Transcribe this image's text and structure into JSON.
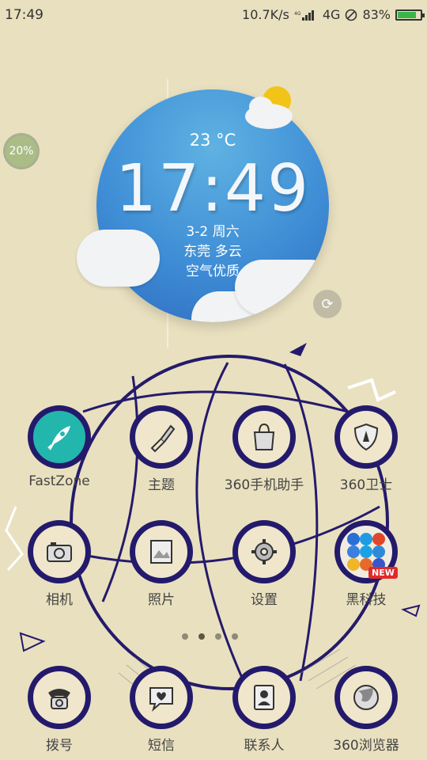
{
  "status_bar": {
    "time": "17:49",
    "network_speed": "10.7K/s",
    "network_type": "4G",
    "battery_percent": "83%",
    "icons": [
      "signal-icon",
      "dnd-icon",
      "battery-icon"
    ]
  },
  "floating_widget": {
    "percent": "20%"
  },
  "weather": {
    "temperature": "23 °C",
    "time": "17:49",
    "date": "3-2 周六",
    "city_condition": "东莞 多云",
    "air_quality": "空气优质"
  },
  "apps": {
    "row1": [
      {
        "label": "FastZone",
        "icon": "rocket-icon"
      },
      {
        "label": "主题",
        "icon": "brush-icon"
      },
      {
        "label": "360手机助手",
        "icon": "shopping-bag-icon"
      },
      {
        "label": "360卫士",
        "icon": "shield-icon"
      }
    ],
    "row2": [
      {
        "label": "相机",
        "icon": "camera-icon"
      },
      {
        "label": "照片",
        "icon": "photo-icon"
      },
      {
        "label": "设置",
        "icon": "gear-icon"
      },
      {
        "label": "黑科技",
        "icon": "app-folder-icon"
      }
    ],
    "dock": [
      {
        "label": "拨号",
        "icon": "phone-icon"
      },
      {
        "label": "短信",
        "icon": "message-icon"
      },
      {
        "label": "联系人",
        "icon": "contacts-icon"
      },
      {
        "label": "360浏览器",
        "icon": "globe-icon"
      }
    ]
  },
  "badge_new": "NEW",
  "page_indicator": {
    "pages": 4,
    "active": 2
  },
  "colors": {
    "background": "#e9e0bf",
    "icon_ring": "#241a6c",
    "weather_blue": "#3f8ed6",
    "fastzone_teal": "#23b6ad"
  }
}
